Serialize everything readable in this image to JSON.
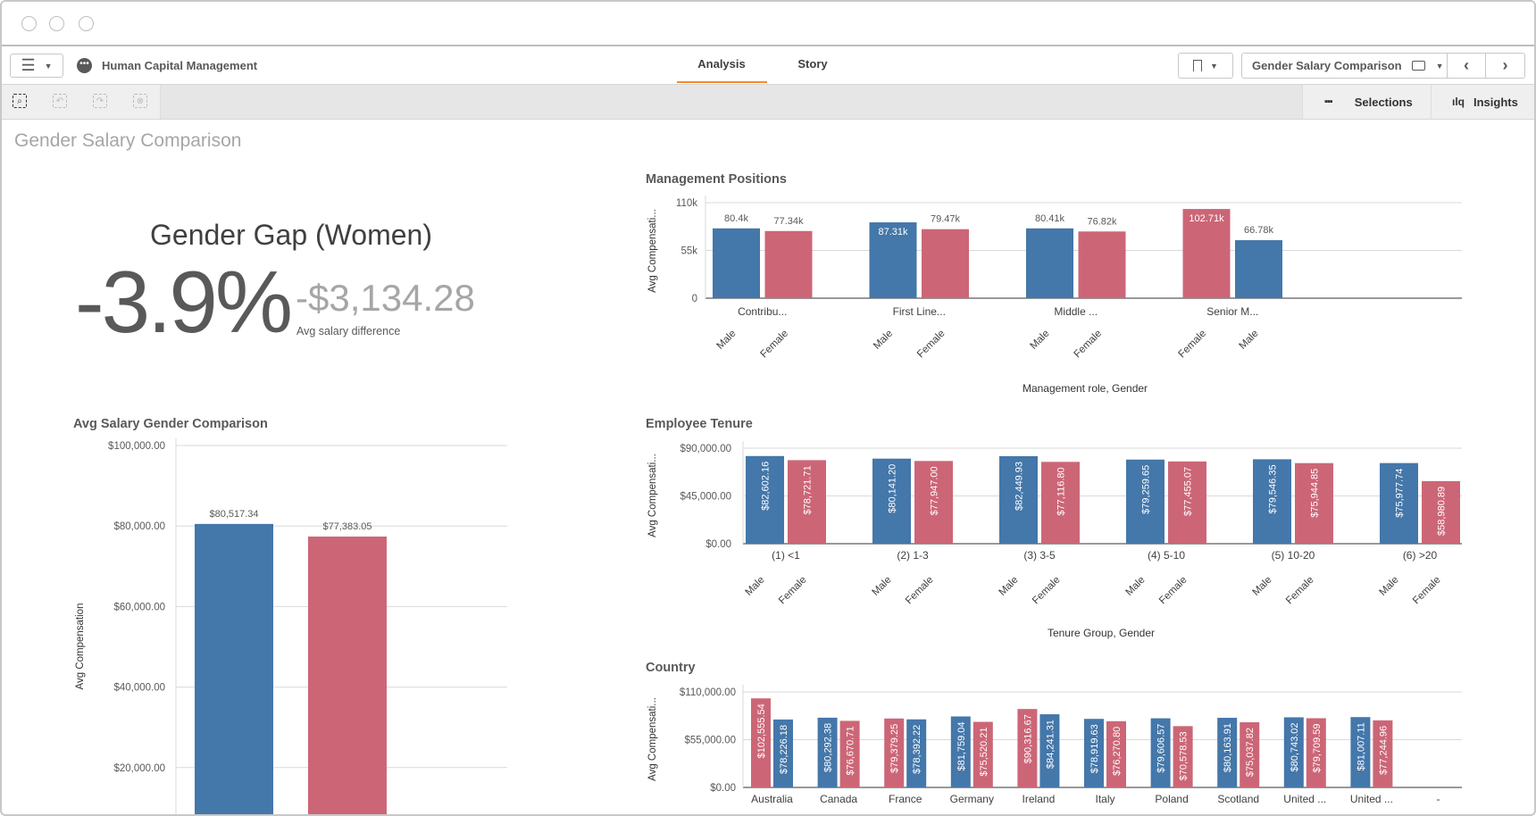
{
  "app": {
    "name": "Human Capital Management",
    "tabs": [
      {
        "label": "Analysis",
        "active": true
      },
      {
        "label": "Story",
        "active": false
      }
    ],
    "sheet_selector": "Gender Salary Comparison",
    "selections_label": "Selections",
    "insights_label": "Insights"
  },
  "icons": {
    "menu": "hamburger-icon",
    "app": "more-dots-icon",
    "bookmark": "bookmark-icon",
    "sheet": "laptop-icon",
    "prev": "chevron-left-icon",
    "next": "chevron-right-icon",
    "smart_search": "smart-search-icon",
    "back": "step-back-icon",
    "forward": "step-forward-icon",
    "clear": "clear-selections-icon",
    "selections": "selections-grid-icon",
    "insights": "insights-icon"
  },
  "colors": {
    "male": "#4477aa",
    "female": "#cc6677",
    "accent": "#f08c2f"
  },
  "sheet": {
    "title": "Gender Salary Comparison"
  },
  "kpi": {
    "title": "Gender Gap (Women)",
    "value": "-3.9%",
    "secondary": "-$3,134.28",
    "secondary_label": "Avg salary difference"
  },
  "chart_data": [
    {
      "id": "avg",
      "type": "bar",
      "title": "Avg Salary Gender Comparison",
      "ylabel": "Avg Compensation",
      "xlabel": "",
      "yticks": [
        "$20,000.00",
        "$40,000.00",
        "$60,000.00",
        "$80,000.00",
        "$100,000.00"
      ],
      "ytick_values": [
        20000,
        40000,
        60000,
        80000,
        100000
      ],
      "ylim": [
        0,
        100000
      ],
      "grid": true,
      "groups": [
        {
          "category": "",
          "bars": [
            {
              "gender": "Male",
              "value": 80517.34,
              "label": "$80,517.34"
            },
            {
              "gender": "Female",
              "value": 77383.05,
              "label": "$77,383.05"
            }
          ]
        }
      ]
    },
    {
      "id": "mgmt",
      "type": "bar",
      "title": "Management Positions",
      "ylabel": "Avg Compensati...",
      "xlabel": "Management role, Gender",
      "yticks": [
        "0",
        "55k",
        "110k"
      ],
      "ytick_values": [
        0,
        55000,
        110000
      ],
      "ylim": [
        0,
        110000
      ],
      "grid": true,
      "groups": [
        {
          "category": "Contribu...",
          "bars": [
            {
              "gender": "Male",
              "value": 80400,
              "label": "80.4k"
            },
            {
              "gender": "Female",
              "value": 77340,
              "label": "77.34k"
            }
          ]
        },
        {
          "category": "First Line...",
          "bars": [
            {
              "gender": "Male",
              "value": 87310,
              "label": "87.31k"
            },
            {
              "gender": "Female",
              "value": 79470,
              "label": "79.47k"
            }
          ]
        },
        {
          "category": "Middle ...",
          "bars": [
            {
              "gender": "Male",
              "value": 80410,
              "label": "80.41k"
            },
            {
              "gender": "Female",
              "value": 76820,
              "label": "76.82k"
            }
          ]
        },
        {
          "category": "Senior M...",
          "bars": [
            {
              "gender": "Female",
              "value": 102710,
              "label": "102.71k"
            },
            {
              "gender": "Male",
              "value": 66780,
              "label": "66.78k"
            }
          ]
        }
      ]
    },
    {
      "id": "tenure",
      "type": "bar",
      "title": "Employee Tenure",
      "ylabel": "Avg Compensati...",
      "xlabel": "Tenure Group, Gender",
      "yticks": [
        "$0.00",
        "$45,000.00",
        "$90,000.00"
      ],
      "ytick_values": [
        0,
        45000,
        90000
      ],
      "ylim": [
        0,
        90000
      ],
      "grid": true,
      "groups": [
        {
          "category": "(1) <1",
          "bars": [
            {
              "gender": "Male",
              "value": 82602.16,
              "label": "$82,602.16"
            },
            {
              "gender": "Female",
              "value": 78721.71,
              "label": "$78,721.71"
            }
          ]
        },
        {
          "category": "(2) 1-3",
          "bars": [
            {
              "gender": "Male",
              "value": 80141.2,
              "label": "$80,141.20"
            },
            {
              "gender": "Female",
              "value": 77947.0,
              "label": "$77,947.00"
            }
          ]
        },
        {
          "category": "(3) 3-5",
          "bars": [
            {
              "gender": "Male",
              "value": 82449.93,
              "label": "$82,449.93"
            },
            {
              "gender": "Female",
              "value": 77116.8,
              "label": "$77,116.80"
            }
          ]
        },
        {
          "category": "(4) 5-10",
          "bars": [
            {
              "gender": "Male",
              "value": 79259.65,
              "label": "$79,259.65"
            },
            {
              "gender": "Female",
              "value": 77455.07,
              "label": "$77,455.07"
            }
          ]
        },
        {
          "category": "(5) 10-20",
          "bars": [
            {
              "gender": "Male",
              "value": 79546.35,
              "label": "$79,546.35"
            },
            {
              "gender": "Female",
              "value": 75944.85,
              "label": "$75,944.85"
            }
          ]
        },
        {
          "category": "(6) >20",
          "bars": [
            {
              "gender": "Male",
              "value": 75977.74,
              "label": "$75,977.74"
            },
            {
              "gender": "Female",
              "value": 58980.89,
              "label": "$58,980.89"
            }
          ]
        }
      ]
    },
    {
      "id": "country",
      "type": "bar",
      "title": "Country",
      "ylabel": "Avg Compensati...",
      "xlabel": "",
      "yticks": [
        "$0.00",
        "$55,000.00",
        "$110,000.00"
      ],
      "ytick_values": [
        0,
        55000,
        110000
      ],
      "ylim": [
        0,
        110000
      ],
      "grid": true,
      "groups": [
        {
          "category": "Australia",
          "bars": [
            {
              "gender": "Female",
              "value": 102555.54,
              "label": "$102,555.54"
            },
            {
              "gender": "Male",
              "value": 78226.18,
              "label": "$78,226.18"
            }
          ]
        },
        {
          "category": "Canada",
          "bars": [
            {
              "gender": "Male",
              "value": 80292.38,
              "label": "$80,292.38"
            },
            {
              "gender": "Female",
              "value": 76670.71,
              "label": "$76,670.71"
            }
          ]
        },
        {
          "category": "France",
          "bars": [
            {
              "gender": "Female",
              "value": 79379.25,
              "label": "$79,379.25"
            },
            {
              "gender": "Male",
              "value": 78392.22,
              "label": "$78,392.22"
            }
          ]
        },
        {
          "category": "Germany",
          "bars": [
            {
              "gender": "Male",
              "value": 81759.04,
              "label": "$81,759.04"
            },
            {
              "gender": "Female",
              "value": 75520.21,
              "label": "$75,520.21"
            }
          ]
        },
        {
          "category": "Ireland",
          "bars": [
            {
              "gender": "Female",
              "value": 90316.67,
              "label": "$90,316.67"
            },
            {
              "gender": "Male",
              "value": 84241.31,
              "label": "$84,241.31"
            }
          ]
        },
        {
          "category": "Italy",
          "bars": [
            {
              "gender": "Male",
              "value": 78919.63,
              "label": "$78,919.63"
            },
            {
              "gender": "Female",
              "value": 76270.8,
              "label": "$76,270.80"
            }
          ]
        },
        {
          "category": "Poland",
          "bars": [
            {
              "gender": "Male",
              "value": 79606.57,
              "label": "$79,606.57"
            },
            {
              "gender": "Female",
              "value": 70578.53,
              "label": "$70,578.53"
            }
          ]
        },
        {
          "category": "Scotland",
          "bars": [
            {
              "gender": "Male",
              "value": 80163.91,
              "label": "$80,163.91"
            },
            {
              "gender": "Female",
              "value": 75037.82,
              "label": "$75,037.82"
            }
          ]
        },
        {
          "category": "United ...",
          "bars": [
            {
              "gender": "Male",
              "value": 80743.02,
              "label": "$80,743.02"
            },
            {
              "gender": "Female",
              "value": 79709.59,
              "label": "$79,709.59"
            }
          ]
        },
        {
          "category": "United ...",
          "bars": [
            {
              "gender": "Male",
              "value": 81007.11,
              "label": "$81,007.11"
            },
            {
              "gender": "Female",
              "value": 77244.96,
              "label": "$77,244.96"
            }
          ]
        },
        {
          "category": "-",
          "bars": []
        }
      ]
    }
  ]
}
